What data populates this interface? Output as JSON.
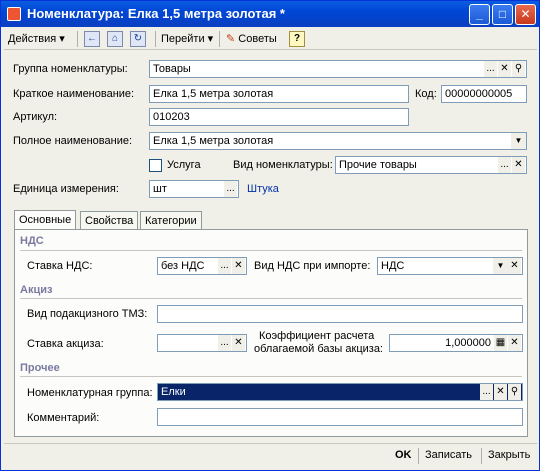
{
  "window": {
    "title": "Номенклатура: Елка 1,5 метра золотая *",
    "minimize_glyph": "_",
    "maximize_glyph": "□",
    "close_glyph": "✕"
  },
  "toolbar": {
    "actions_label": "Действия",
    "goto_label": "Перейти",
    "tips_label": "Советы",
    "help_glyph": "?",
    "dropdown_glyph": "▾"
  },
  "form": {
    "group_label": "Группа номенклатуры:",
    "group_value": "Товары",
    "short_name_label": "Краткое наименование:",
    "short_name_value": "Елка 1,5 метра золотая",
    "code_label": "Код:",
    "code_value": "00000000005",
    "article_label": "Артикул:",
    "article_value": "010203",
    "full_name_label": "Полное наименование:",
    "full_name_value": "Елка 1,5 метра золотая",
    "service_label": "Услуга",
    "item_type_label": "Вид номенклатуры:",
    "item_type_value": "Прочие товары",
    "unit_label": "Единица измерения:",
    "unit_value": "шт",
    "unit_link": "Штука"
  },
  "tabs": [
    {
      "label": "Основные"
    },
    {
      "label": "Свойства"
    },
    {
      "label": "Категории"
    }
  ],
  "main_tab": {
    "vat_section": "НДС",
    "vat_rate_label": "Ставка НДС:",
    "vat_rate_value": "без НДС",
    "vat_import_label": "Вид НДС при импорте:",
    "vat_import_value": "НДС",
    "excise_section": "Акциз",
    "excise_type_label": "Вид подакцизного ТМЗ:",
    "excise_type_value": "",
    "excise_rate_label": "Ставка акциза:",
    "excise_rate_value": "",
    "coef_label_1": "Коэффициент расчета",
    "coef_label_2": "облагаемой базы акциза:",
    "coef_value": "1,000000",
    "other_section": "Прочее",
    "nom_group_label": "Номенклатурная группа:",
    "nom_group_value": "Елки",
    "comment_label": "Комментарий:",
    "comment_value": ""
  },
  "buttons": {
    "select_glyph": "...",
    "clear_glyph": "✕",
    "search_glyph": "🔍",
    "calc_glyph": "▦"
  },
  "bottom": {
    "ok_label": "OK",
    "save_label": "Записать",
    "close_label": "Закрыть"
  }
}
